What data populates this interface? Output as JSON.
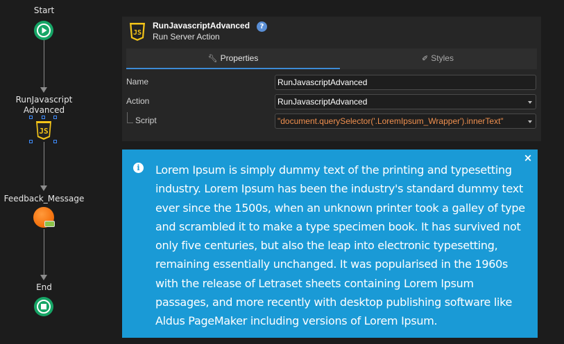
{
  "flow": {
    "start_label": "Start",
    "js_node_label_line1": "RunJavascript",
    "js_node_label_line2": "Advanced",
    "feedback_label": "Feedback_Message",
    "end_label": "End"
  },
  "panel": {
    "title": "RunJavascriptAdvanced",
    "subtitle": "Run Server Action",
    "help": "?",
    "tabs": [
      {
        "label": "Properties",
        "icon": "wrench-icon",
        "active": true
      },
      {
        "label": "Styles",
        "icon": "brush-icon",
        "active": false
      }
    ],
    "rows": [
      {
        "label": "Name",
        "value": "RunJavascriptAdvanced",
        "dropdown": false
      },
      {
        "label": "Action",
        "value": "RunJavascriptAdvanced",
        "dropdown": true
      },
      {
        "label": "Script",
        "value": "\"document.querySelector('.LoremIpsum_Wrapper').innerText\"",
        "dropdown": true
      }
    ]
  },
  "banner": {
    "icon": "info-icon",
    "close": "×",
    "text": "Lorem Ipsum is simply dummy text of the printing and typesetting industry. Lorem Ipsum has been the industry's standard dummy text ever since the 1500s, when an unknown printer took a galley of type and scrambled it to make a type specimen book. It has survived not only five centuries, but also the leap into electronic typesetting, remaining essentially unchanged. It was popularised in the 1960s with the release of Letraset sheets containing Lorem Ipsum passages, and more recently with desktop publishing software like Aldus PageMaker including versions of Lorem Ipsum."
  },
  "colors": {
    "background": "#1c1c1c",
    "panel": "#262626",
    "banner": "#1a9ad6",
    "start_end_node": "#16a566",
    "js_badge": "#f5c518",
    "feedback_node": "#f57410",
    "active_tab_underline": "#3d8bd6",
    "expression_text": "#f0904f"
  }
}
